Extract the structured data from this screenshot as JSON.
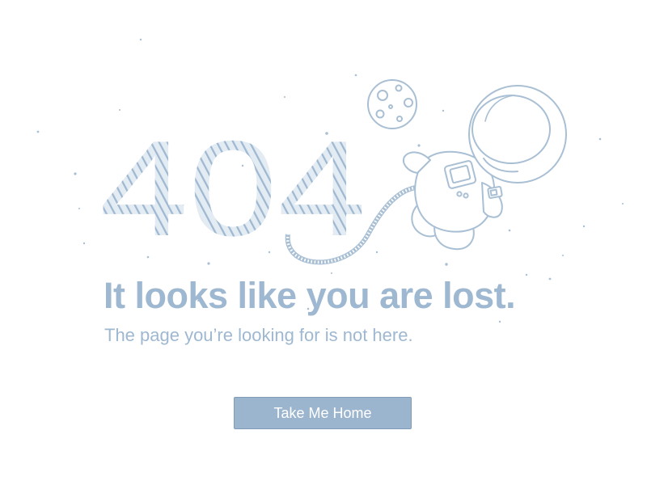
{
  "error": {
    "code": "404",
    "headline": "It looks like you are lost.",
    "message": "The page you’re looking for is not here."
  },
  "actions": {
    "home_label": "Take Me Home"
  },
  "illustration": {
    "icons": [
      "astronaut-illustration",
      "moon-illustration",
      "tether-cord"
    ]
  },
  "colors": {
    "accent": "#9fb8d1",
    "line": "#a9bfd4",
    "button_bg": "#9cb5ce",
    "button_border": "#7f9bb8",
    "background": "#ffffff"
  }
}
